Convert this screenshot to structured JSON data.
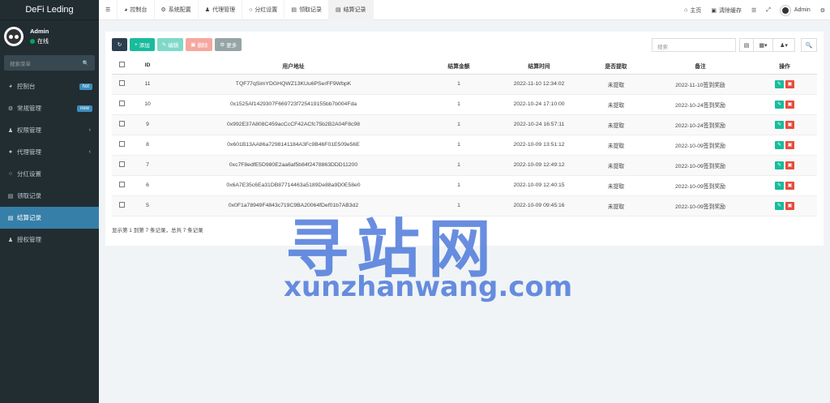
{
  "brand": "DeFi Leding",
  "user": {
    "name": "Admin",
    "status": "在线"
  },
  "sidebar": {
    "search_placeholder": "搜索菜单",
    "items": [
      {
        "label": "控制台",
        "icon": "dashboard-icon",
        "badge": "hot"
      },
      {
        "label": "常规管理",
        "icon": "cogs-icon",
        "badge": "new"
      },
      {
        "label": "权限管理",
        "icon": "group-icon",
        "chevron": "‹"
      },
      {
        "label": "代理管理",
        "icon": "user-circle-icon",
        "chevron": "‹"
      },
      {
        "label": "分红设置",
        "icon": "circle-icon"
      },
      {
        "label": "领取记录",
        "icon": "list-icon"
      },
      {
        "label": "结算记录",
        "icon": "list-icon",
        "active": true
      },
      {
        "label": "授权管理",
        "icon": "group-icon"
      }
    ]
  },
  "topbar": {
    "tabs": [
      {
        "label": "控制台",
        "icon": "dashboard-icon"
      },
      {
        "label": "系统配置",
        "icon": "gear-icon"
      },
      {
        "label": "代理管理",
        "icon": "user-icon"
      },
      {
        "label": "分红设置",
        "icon": "circle-icon"
      },
      {
        "label": "领取记录",
        "icon": "list-icon"
      },
      {
        "label": "结算记录",
        "icon": "list-icon",
        "active": true
      }
    ],
    "home": "主页",
    "clear_cache": "清除缓存",
    "admin": "Admin"
  },
  "toolbar": {
    "add": "添加",
    "edit": "编辑",
    "delete": "删除",
    "more": "更多",
    "search_placeholder": "搜索"
  },
  "table": {
    "headers": [
      "ID",
      "用户地址",
      "结算金额",
      "结算时间",
      "是否提取",
      "备注",
      "操作"
    ],
    "rows": [
      {
        "id": "11",
        "address": "TQF77qSimYDGHQWZ13KUu6PSerFF9WbpK",
        "amount": "1",
        "time": "2022-11-10 12:34:02",
        "withdrawn": "未提取",
        "note": "2022-11-10签到奖励"
      },
      {
        "id": "10",
        "address": "0x1525Af1429307F669723f725419155bb7b004Fda",
        "amount": "1",
        "time": "2022-10-24 17:10:00",
        "withdrawn": "未提取",
        "note": "2022-10-24签到奖励"
      },
      {
        "id": "9",
        "address": "0x992E37A808C459acCcCF42ACfc75b2B2A04F8c98",
        "amount": "1",
        "time": "2022-10-24 16:57:11",
        "withdrawn": "未提取",
        "note": "2022-10-24签到奖励"
      },
      {
        "id": "8",
        "address": "0x601B13AA86a7298141184A3Fc9B46F01E509e56E",
        "amount": "1",
        "time": "2022-10-09 13:51:12",
        "withdrawn": "未提取",
        "note": "2022-10-09签到奖励"
      },
      {
        "id": "7",
        "address": "0xc7F8edfE5D980E2aa6af5b84f2478863DDD11200",
        "amount": "1",
        "time": "2022-10-09 12:49:12",
        "withdrawn": "未提取",
        "note": "2022-10-09签到奖励"
      },
      {
        "id": "6",
        "address": "0x6A7E35c6Ea31DB87714463a5189De88a9D0E58e0",
        "amount": "1",
        "time": "2022-10-09 12:40:15",
        "withdrawn": "未提取",
        "note": "2022-10-09签到奖励"
      },
      {
        "id": "5",
        "address": "0x0F1a78949F4843c719C9BA20064fDef01b7AB3d2",
        "amount": "1",
        "time": "2022-10-09 09:45:16",
        "withdrawn": "未提取",
        "note": "2022-10-09签到奖励"
      }
    ],
    "summary": "显示第 1 到第 7 条记录，总共 7 条记录"
  },
  "watermark": {
    "big": "寻站网",
    "small": "xunzhanwang.com"
  },
  "colors": {
    "sidebar_bg": "#222d32",
    "active": "#367fa9",
    "success": "#18bc9c",
    "danger": "#e74c3c"
  }
}
